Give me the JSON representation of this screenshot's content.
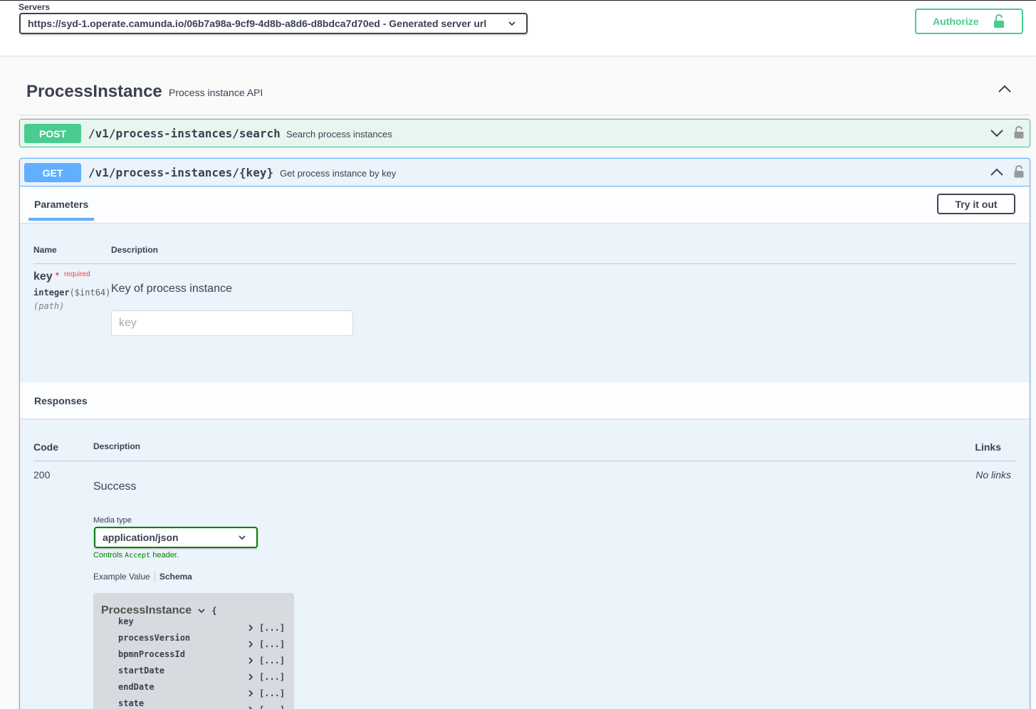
{
  "servers": {
    "label": "Servers",
    "selected": "https://syd-1.operate.camunda.io/06b7a98a-9cf9-4d8b-a8d6-d8bdca7d70ed - Generated server url"
  },
  "authorize": {
    "label": "Authorize"
  },
  "tag": {
    "name": "ProcessInstance",
    "description": "Process instance API"
  },
  "operations": {
    "post": {
      "method": "POST",
      "path": "/v1/process-instances/search",
      "summary": "Search process instances"
    },
    "get": {
      "method": "GET",
      "path": "/v1/process-instances/{key}",
      "summary": "Get process instance by key"
    }
  },
  "parameters": {
    "tab": "Parameters",
    "try_it_out": "Try it out",
    "col_name": "Name",
    "col_description": "Description",
    "param": {
      "name": "key",
      "required_star": "*",
      "required_text": "required",
      "type": "integer",
      "format": "($int64)",
      "location": "(path)",
      "description": "Key of process instance",
      "placeholder": "key"
    }
  },
  "responses": {
    "title": "Responses",
    "col_code": "Code",
    "col_description": "Description",
    "col_links": "Links",
    "row": {
      "code": "200",
      "description": "Success",
      "links": "No links"
    },
    "media_type_label": "Media type",
    "media_type": "application/json",
    "controls_prefix": "Controls",
    "controls_mono": "Accept",
    "controls_suffix": "header.",
    "example_tab": "Example Value",
    "schema_tab": "Schema"
  },
  "schema": {
    "name": "ProcessInstance",
    "open_brace": "{",
    "properties": [
      {
        "name": "key",
        "value": "[...]"
      },
      {
        "name": "processVersion",
        "value": "[...]"
      },
      {
        "name": "bpmnProcessId",
        "value": "[...]"
      },
      {
        "name": "startDate",
        "value": "[...]"
      },
      {
        "name": "endDate",
        "value": "[...]"
      },
      {
        "name": "state",
        "value": "[...]"
      }
    ]
  },
  "colors": {
    "post": "#49cc90",
    "get": "#61affe",
    "required": "#f93e3e",
    "accept": "#008000"
  }
}
